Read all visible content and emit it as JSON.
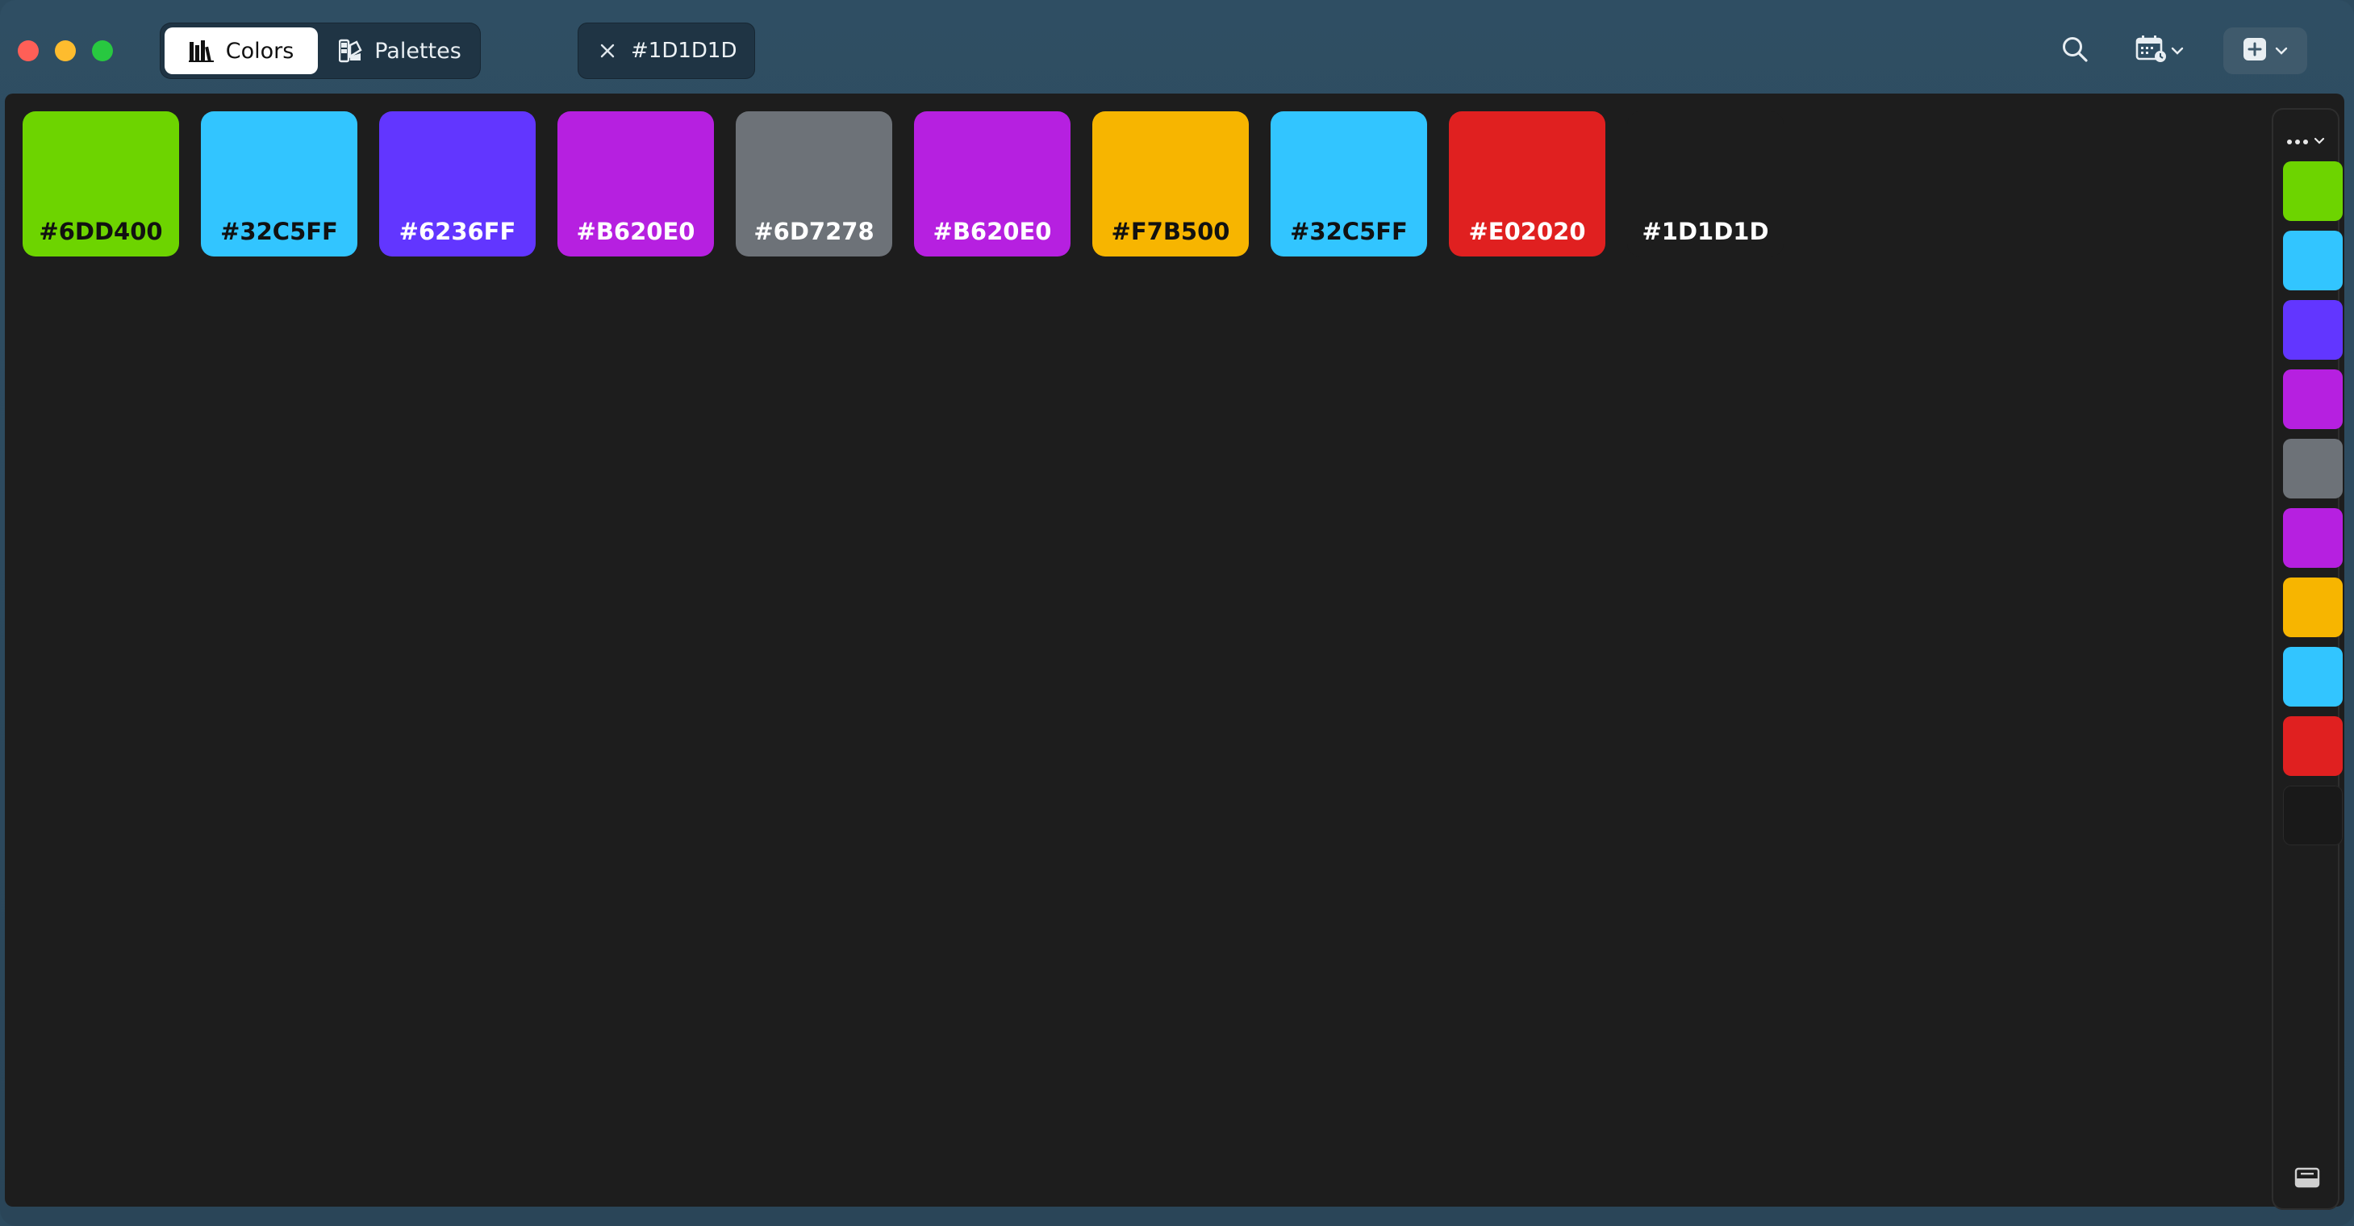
{
  "window": {
    "traffic_lights": [
      "close",
      "minimize",
      "maximize"
    ]
  },
  "toolbar": {
    "segments": [
      {
        "label": "Colors",
        "icon": "books-icon",
        "active": true
      },
      {
        "label": "Palettes",
        "icon": "palettes-icon",
        "active": false
      }
    ],
    "open_tab": {
      "label": "#1D1D1D",
      "close_icon": "close-icon"
    },
    "tools": [
      {
        "icon": "search-icon"
      },
      {
        "icon": "calendar-icon",
        "dropdown": true
      },
      {
        "icon": "add-icon",
        "dropdown": true
      }
    ]
  },
  "colors": [
    {
      "hex": "#6DD400",
      "label": "#6DD400",
      "text_color": "#111111"
    },
    {
      "hex": "#32C5FF",
      "label": "#32C5FF",
      "text_color": "#111111"
    },
    {
      "hex": "#6236FF",
      "label": "#6236FF",
      "text_color": "#ffffff"
    },
    {
      "hex": "#B620E0",
      "label": "#B620E0",
      "text_color": "#ffffff"
    },
    {
      "hex": "#6D7278",
      "label": "#6D7278",
      "text_color": "#ffffff"
    },
    {
      "hex": "#B620E0",
      "label": "#B620E0",
      "text_color": "#ffffff"
    },
    {
      "hex": "#F7B500",
      "label": "#F7B500",
      "text_color": "#111111"
    },
    {
      "hex": "#32C5FF",
      "label": "#32C5FF",
      "text_color": "#111111"
    },
    {
      "hex": "#E02020",
      "label": "#E02020",
      "text_color": "#ffffff"
    },
    {
      "hex": "#1D1D1D",
      "label": "#1D1D1D",
      "text_color": "#ffffff"
    }
  ],
  "sidebar": {
    "menu_icon": "ellipsis-icon",
    "bottom_icon": "drawer-icon"
  }
}
